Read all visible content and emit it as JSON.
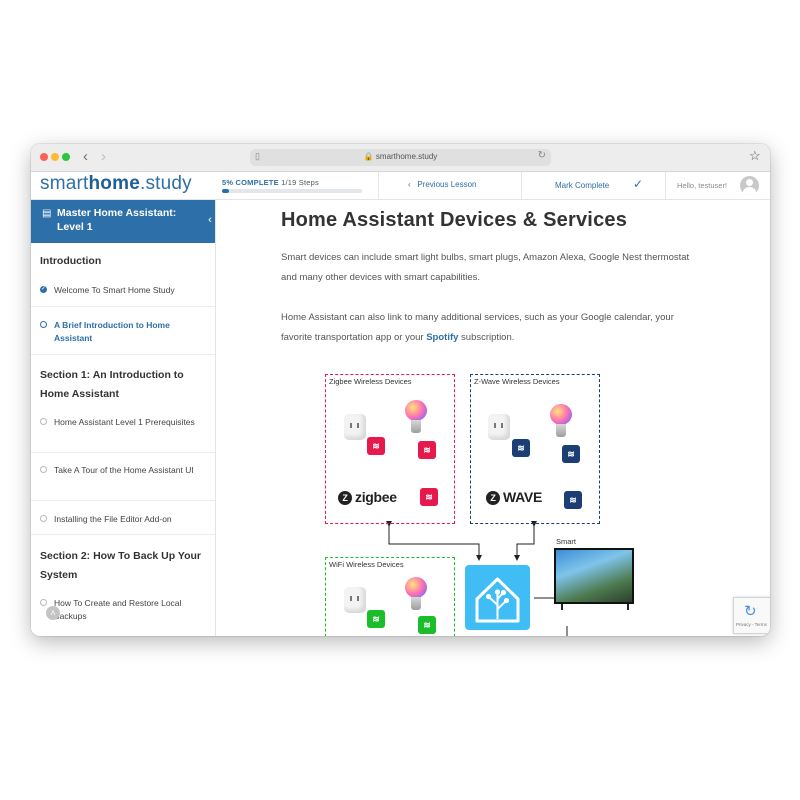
{
  "browser": {
    "url": "smarthome.study"
  },
  "site": {
    "logo_light": "smart",
    "logo_bold": "home",
    "logo_rest": ".study"
  },
  "topbar": {
    "progress_pct": "5% COMPLETE",
    "progress_steps": "1/19 Steps",
    "progress_fraction": 0.05,
    "previous_label": "Previous Lesson",
    "mark_complete_label": "Mark Complete",
    "greeting": "Hello, testuser!"
  },
  "sidebar": {
    "course_title": "Master Home Assistant: Level 1",
    "sections": [
      {
        "title": "Introduction",
        "lessons": [
          {
            "label": "Welcome To Smart Home Study",
            "status": "done"
          },
          {
            "label": "A Brief Introduction to Home Assistant",
            "status": "current"
          }
        ]
      },
      {
        "title": "Section 1: An Introduction to Home Assistant",
        "lessons": [
          {
            "label": "Home Assistant Level 1 Prerequisites",
            "status": "todo"
          },
          {
            "label": "Take A Tour of the Home Assistant UI",
            "status": "todo"
          },
          {
            "label": "Installing the File Editor Add-on",
            "status": "todo"
          }
        ]
      },
      {
        "title": "Section 2: How To Back Up Your System",
        "lessons": [
          {
            "label": "How To Create and Restore Local Backups",
            "status": "todo"
          }
        ]
      }
    ]
  },
  "main": {
    "title": "Home Assistant Devices & Services",
    "paragraph1": "Smart devices can include smart light bulbs, smart plugs, Amazon Alexa, Google Nest thermostat and many other devices with smart capabilities.",
    "paragraph2_pre": "Home Assistant can also link to many additional services, such as your Google calendar, your favorite transportation app or your ",
    "paragraph2_brand": "Spotify",
    "paragraph2_post": " subscription."
  },
  "diagram": {
    "zigbee_box_label": "Zigbee Wireless Devices",
    "zwave_box_label": "Z-Wave Wireless Devices",
    "wifi_box_label": "WiFi Wireless Devices",
    "zigbee_logo": "zigbee",
    "zwave_logo": "WAVE",
    "zwave_logo_letter": "Z",
    "tv_label": "Smart TV",
    "colors": {
      "zigbee": "#e5194b",
      "zwave": "#1b3f75",
      "wifi": "#1bbd2a",
      "home_assistant": "#41bdf5"
    }
  },
  "recaptcha": {
    "links": "Privacy - Terms"
  },
  "colors": {
    "brand": "#2d6fa8"
  }
}
